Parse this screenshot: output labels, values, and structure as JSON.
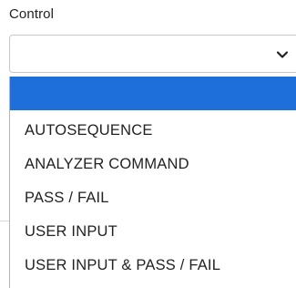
{
  "field": {
    "label": "Control",
    "selected_value": ""
  },
  "icons": {
    "dropdown": "chevron-down-icon"
  },
  "colors": {
    "highlight": "#1e6fd9",
    "text": "#222222",
    "border": "#c7c7c7"
  },
  "dropdown": {
    "options": [
      {
        "label": "",
        "selected": true
      },
      {
        "label": "AUTOSEQUENCE",
        "selected": false
      },
      {
        "label": "ANALYZER COMMAND",
        "selected": false
      },
      {
        "label": "PASS / FAIL",
        "selected": false
      },
      {
        "label": "USER INPUT",
        "selected": false
      },
      {
        "label": "USER INPUT & PASS / FAIL",
        "selected": false
      }
    ]
  }
}
